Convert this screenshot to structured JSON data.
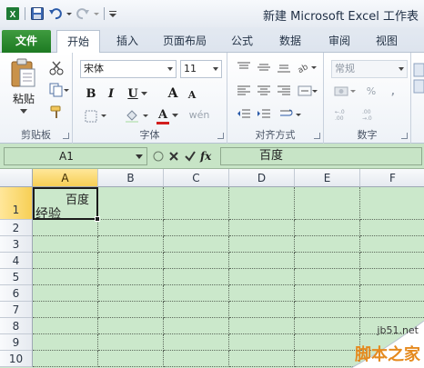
{
  "window": {
    "title": "新建 Microsoft Excel 工作表"
  },
  "quick_access": {
    "icons": [
      "excel-logo-icon",
      "save-icon",
      "undo-icon",
      "redo-icon",
      "customize-qat-icon"
    ]
  },
  "tabs": [
    {
      "label": "文件",
      "active": false
    },
    {
      "label": "开始",
      "active": true
    },
    {
      "label": "插入",
      "active": false
    },
    {
      "label": "页面布局",
      "active": false
    },
    {
      "label": "公式",
      "active": false
    },
    {
      "label": "数据",
      "active": false
    },
    {
      "label": "审阅",
      "active": false
    },
    {
      "label": "视图",
      "active": false
    }
  ],
  "ribbon": {
    "clipboard": {
      "paste_label": "粘贴",
      "group_label": "剪贴板"
    },
    "font": {
      "font_name": "宋体",
      "font_size": "11",
      "bold": "B",
      "italic": "I",
      "underline": "U",
      "grow": "A",
      "shrink": "A",
      "font_color": "A",
      "phonetic": "wén",
      "group_label": "字体"
    },
    "alignment": {
      "group_label": "对齐方式"
    },
    "number": {
      "format": "常规",
      "group_label": "数字"
    }
  },
  "formula_bar": {
    "name_box": "A1",
    "fx_label": "fx",
    "content": "百度"
  },
  "sheet": {
    "columns": [
      "A",
      "B",
      "C",
      "D",
      "E",
      "F"
    ],
    "rows": [
      "1",
      "2",
      "3",
      "4",
      "5",
      "6",
      "7",
      "8",
      "9",
      "10"
    ],
    "selected_cell": "A1",
    "cells": {
      "A1_line1": "百度",
      "A1_line2": "经验"
    },
    "fill_color": "#cbe8cb"
  },
  "watermark": {
    "site": "jb51.net",
    "brand": "脚本之家"
  }
}
